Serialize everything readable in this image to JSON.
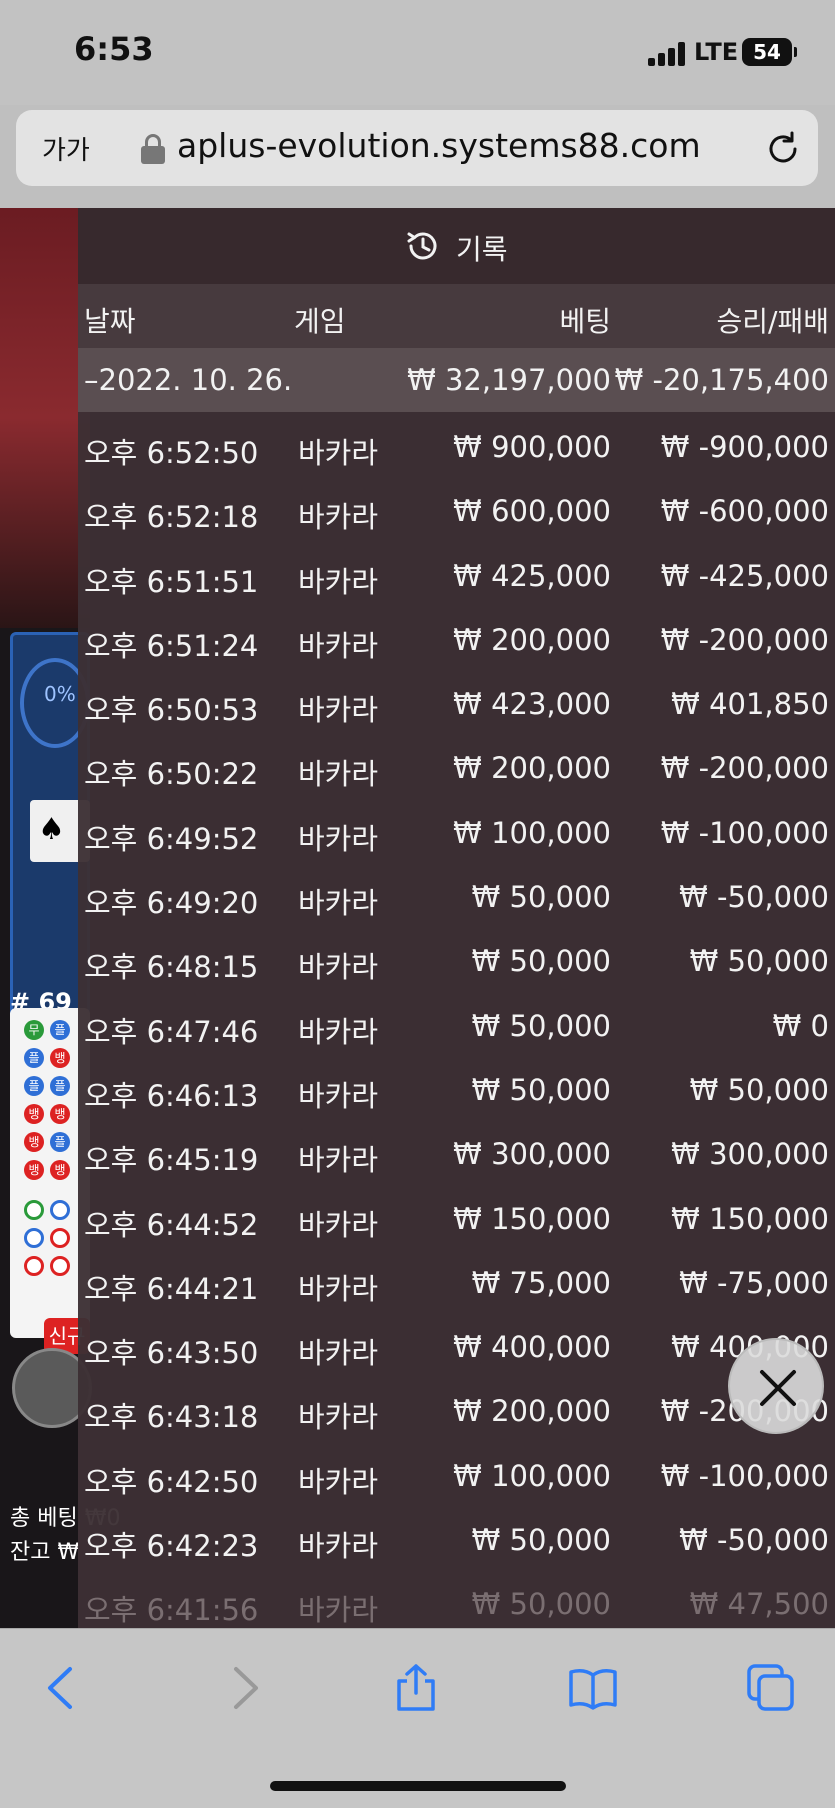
{
  "status": {
    "time": "6:53",
    "network": "LTE",
    "battery": "54"
  },
  "browser": {
    "text_size_label": "가가",
    "url": "aplus-evolution.systems88.com"
  },
  "background_game": {
    "percent": "0%",
    "round": "# 69",
    "new_badge": "신규",
    "total_bet": "총 베팅 ₩0",
    "balance": "잔고 ₩"
  },
  "history": {
    "title": "기록",
    "columns": {
      "date": "날짜",
      "game": "게임",
      "bet": "베팅",
      "result": "승리/패배"
    },
    "summary": {
      "date": "–2022. 10. 26.",
      "bet": "₩ 32,197,000",
      "result": "₩ -20,175,400"
    },
    "rows": [
      {
        "time": "오후 6:52:50",
        "game": "바카라",
        "bet": "₩ 900,000",
        "result": "₩ -900,000"
      },
      {
        "time": "오후 6:52:18",
        "game": "바카라",
        "bet": "₩ 600,000",
        "result": "₩ -600,000"
      },
      {
        "time": "오후 6:51:51",
        "game": "바카라",
        "bet": "₩ 425,000",
        "result": "₩ -425,000"
      },
      {
        "time": "오후 6:51:24",
        "game": "바카라",
        "bet": "₩ 200,000",
        "result": "₩ -200,000"
      },
      {
        "time": "오후 6:50:53",
        "game": "바카라",
        "bet": "₩ 423,000",
        "result": "₩ 401,850"
      },
      {
        "time": "오후 6:50:22",
        "game": "바카라",
        "bet": "₩ 200,000",
        "result": "₩ -200,000"
      },
      {
        "time": "오후 6:49:52",
        "game": "바카라",
        "bet": "₩ 100,000",
        "result": "₩ -100,000"
      },
      {
        "time": "오후 6:49:20",
        "game": "바카라",
        "bet": "₩ 50,000",
        "result": "₩ -50,000"
      },
      {
        "time": "오후 6:48:15",
        "game": "바카라",
        "bet": "₩ 50,000",
        "result": "₩ 50,000"
      },
      {
        "time": "오후 6:47:46",
        "game": "바카라",
        "bet": "₩ 50,000",
        "result": "₩ 0"
      },
      {
        "time": "오후 6:46:13",
        "game": "바카라",
        "bet": "₩ 50,000",
        "result": "₩ 50,000"
      },
      {
        "time": "오후 6:45:19",
        "game": "바카라",
        "bet": "₩ 300,000",
        "result": "₩ 300,000"
      },
      {
        "time": "오후 6:44:52",
        "game": "바카라",
        "bet": "₩ 150,000",
        "result": "₩ 150,000"
      },
      {
        "time": "오후 6:44:21",
        "game": "바카라",
        "bet": "₩ 75,000",
        "result": "₩ -75,000"
      },
      {
        "time": "오후 6:43:50",
        "game": "바카라",
        "bet": "₩ 400,000",
        "result": "₩ 400,000"
      },
      {
        "time": "오후 6:43:18",
        "game": "바카라",
        "bet": "₩ 200,000",
        "result": "₩ -200,000"
      },
      {
        "time": "오후 6:42:50",
        "game": "바카라",
        "bet": "₩ 100,000",
        "result": "₩ -100,000"
      },
      {
        "time": "오후 6:42:23",
        "game": "바카라",
        "bet": "₩ 50,000",
        "result": "₩ -50,000"
      },
      {
        "time": "오후 6:41:56",
        "game": "바카라",
        "bet": "₩ 50,000",
        "result": "₩ 47,500"
      }
    ]
  },
  "colors": {
    "panel": "#3c3034",
    "header": "#37292d",
    "accent": "#2f7cf6"
  }
}
